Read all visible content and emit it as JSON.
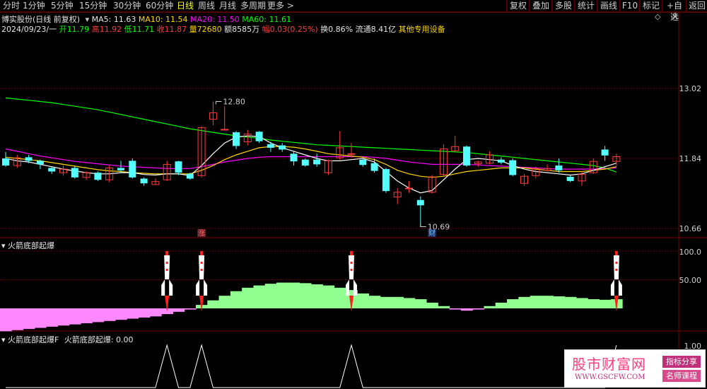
{
  "toolbar": {
    "periods": [
      "分时",
      "1分钟",
      "5分钟",
      "15分钟",
      "30分钟",
      "60分钟",
      "日线",
      "周线",
      "月线",
      "多周期",
      "更多 >"
    ],
    "active_period": "日线",
    "buttons": [
      "复权",
      "叠加",
      "多股",
      "统计",
      "画线",
      "F10",
      "标记",
      "+自选",
      "返回"
    ]
  },
  "header": {
    "stock_title": "博实股份(日线 前复权)",
    "ma5_label": "MA5: 11.63",
    "ma10_label": "MA10: 11.54",
    "ma20_label": "MA20: 11.50",
    "ma60_label": "MA60: 11.61",
    "date": "2024/09/23/一",
    "open": "开11.79",
    "high": "高11.92",
    "low": "低11.71",
    "close": "收11.87",
    "volume": "量72680",
    "amount": "额8585万",
    "change": "幅0.03(0.25%)",
    "turnover": "换0.86%",
    "float": "流通8.41亿",
    "sector": "其他专用设备"
  },
  "main_chart": {
    "y_ticks": [
      "13.02",
      "11.84",
      "10.66"
    ],
    "annotation_high": "12.80",
    "annotation_low": "10.69",
    "marker_zhang": "涨",
    "marker_cai": "财"
  },
  "indicator1": {
    "title": "火箭底部起爆",
    "y_ticks": [
      "100.0",
      "50.00"
    ]
  },
  "indicator2": {
    "title": "火箭底部起爆F",
    "subtitle": "火箭底部起爆: 0.00",
    "y_ticks": [
      "1.00"
    ]
  },
  "watermark": {
    "main": "股市财富网",
    "url": "WWW.GSCFW.COM",
    "tag1": "指标分享",
    "tag2": "名师课程"
  },
  "colors": {
    "up": "#ff3b3b",
    "down": "#54ffff",
    "ma5": "#ffffff",
    "ma10": "#ffd700",
    "ma20": "#ff00ff",
    "ma60": "#00ff00",
    "bar_green": "#90ff90",
    "bar_pink": "#ff88ff",
    "grid": "#7a0000"
  },
  "chart_data": {
    "type": "candlestick",
    "title": "博实股份(日线 前复权)",
    "ylim": [
      10.66,
      13.02
    ],
    "candles": [
      {
        "o": 11.84,
        "c": 11.72,
        "h": 11.95,
        "l": 11.7
      },
      {
        "o": 11.72,
        "c": 11.85,
        "h": 11.9,
        "l": 11.68
      },
      {
        "o": 11.86,
        "c": 11.8,
        "h": 11.9,
        "l": 11.76
      },
      {
        "o": 11.8,
        "c": 11.74,
        "h": 11.82,
        "l": 11.66
      },
      {
        "o": 11.68,
        "c": 11.62,
        "h": 11.7,
        "l": 11.58
      },
      {
        "o": 11.6,
        "c": 11.66,
        "h": 11.72,
        "l": 11.55
      },
      {
        "o": 11.68,
        "c": 11.52,
        "h": 11.72,
        "l": 11.5
      },
      {
        "o": 11.52,
        "c": 11.6,
        "h": 11.62,
        "l": 11.48
      },
      {
        "o": 11.6,
        "c": 11.48,
        "h": 11.62,
        "l": 11.46
      },
      {
        "o": 11.48,
        "c": 11.68,
        "h": 11.72,
        "l": 11.44
      },
      {
        "o": 11.68,
        "c": 11.64,
        "h": 11.8,
        "l": 11.6
      },
      {
        "o": 11.8,
        "c": 11.52,
        "h": 11.84,
        "l": 11.5
      },
      {
        "o": 11.5,
        "c": 11.42,
        "h": 11.52,
        "l": 11.38
      },
      {
        "o": 11.4,
        "c": 11.45,
        "h": 11.5,
        "l": 11.4
      },
      {
        "o": 11.48,
        "c": 11.74,
        "h": 11.8,
        "l": 11.46
      },
      {
        "o": 11.79,
        "c": 11.6,
        "h": 11.8,
        "l": 11.56
      },
      {
        "o": 11.58,
        "c": 11.5,
        "h": 11.6,
        "l": 11.48
      },
      {
        "o": 11.55,
        "c": 12.36,
        "h": 12.38,
        "l": 11.52
      },
      {
        "o": 12.5,
        "c": 12.61,
        "h": 12.8,
        "l": 12.4
      },
      {
        "o": 12.33,
        "c": 12.33,
        "h": 12.72,
        "l": 12.32
      },
      {
        "o": 12.28,
        "c": 12.05,
        "h": 12.3,
        "l": 12.0
      },
      {
        "o": 12.12,
        "c": 12.25,
        "h": 12.32,
        "l": 12.06
      },
      {
        "o": 12.29,
        "c": 12.13,
        "h": 12.3,
        "l": 12.1
      },
      {
        "o": 12.08,
        "c": 12.02,
        "h": 12.12,
        "l": 11.95
      },
      {
        "o": 12.06,
        "c": 11.99,
        "h": 12.1,
        "l": 11.95
      },
      {
        "o": 11.92,
        "c": 11.79,
        "h": 11.95,
        "l": 11.72
      },
      {
        "o": 11.82,
        "c": 11.72,
        "h": 11.84,
        "l": 11.7
      },
      {
        "o": 11.82,
        "c": 11.74,
        "h": 11.92,
        "l": 11.7
      },
      {
        "o": 11.6,
        "c": 11.8,
        "h": 11.82,
        "l": 11.56
      },
      {
        "o": 11.85,
        "c": 12.02,
        "h": 12.3,
        "l": 11.82
      },
      {
        "o": 11.92,
        "c": 11.92,
        "h": 12.1,
        "l": 11.86
      },
      {
        "o": 11.82,
        "c": 11.73,
        "h": 11.84,
        "l": 11.7
      },
      {
        "o": 11.76,
        "c": 11.63,
        "h": 11.84,
        "l": 11.6
      },
      {
        "o": 11.66,
        "c": 11.29,
        "h": 11.68,
        "l": 11.26
      },
      {
        "o": 11.19,
        "c": 11.27,
        "h": 11.34,
        "l": 11.07
      },
      {
        "o": 11.34,
        "c": 11.34,
        "h": 11.46,
        "l": 11.26
      },
      {
        "o": 11.14,
        "c": 11.05,
        "h": 11.2,
        "l": 10.69
      },
      {
        "o": 11.27,
        "c": 11.53,
        "h": 11.56,
        "l": 11.25
      },
      {
        "o": 11.57,
        "c": 12.0,
        "h": 12.08,
        "l": 11.55
      },
      {
        "o": 11.97,
        "c": 12.04,
        "h": 12.22,
        "l": 11.94
      },
      {
        "o": 12.04,
        "c": 11.72,
        "h": 12.06,
        "l": 11.7
      },
      {
        "o": 11.75,
        "c": 11.78,
        "h": 11.8,
        "l": 11.7
      },
      {
        "o": 11.76,
        "c": 11.9,
        "h": 11.96,
        "l": 11.74
      },
      {
        "o": 11.82,
        "c": 11.77,
        "h": 11.86,
        "l": 11.74
      },
      {
        "o": 11.81,
        "c": 11.56,
        "h": 11.84,
        "l": 11.54
      },
      {
        "o": 11.42,
        "c": 11.54,
        "h": 11.58,
        "l": 11.38
      },
      {
        "o": 11.55,
        "c": 11.67,
        "h": 11.7,
        "l": 11.5
      },
      {
        "o": 11.64,
        "c": 11.67,
        "h": 11.74,
        "l": 11.62
      },
      {
        "o": 11.72,
        "c": 11.64,
        "h": 11.84,
        "l": 11.6
      },
      {
        "o": 11.53,
        "c": 11.46,
        "h": 11.56,
        "l": 11.44
      },
      {
        "o": 11.46,
        "c": 11.57,
        "h": 11.62,
        "l": 11.38
      },
      {
        "o": 11.6,
        "c": 11.79,
        "h": 11.84,
        "l": 11.58
      },
      {
        "o": 11.99,
        "c": 11.89,
        "h": 12.05,
        "l": 11.8
      },
      {
        "o": 11.79,
        "c": 11.87,
        "h": 11.92,
        "l": 11.71
      }
    ],
    "ma5": [
      11.84,
      11.8,
      11.78,
      11.74,
      11.7,
      11.66,
      11.63,
      11.6,
      11.58,
      11.58,
      11.6,
      11.6,
      11.57,
      11.56,
      11.58,
      11.58,
      11.55,
      11.72,
      11.92,
      12.1,
      12.2,
      12.22,
      12.21,
      12.1,
      12.02,
      11.96,
      11.9,
      11.84,
      11.8,
      11.8,
      11.82,
      11.84,
      11.78,
      11.62,
      11.46,
      11.34,
      11.26,
      11.3,
      11.48,
      11.66,
      11.82,
      11.84,
      11.82,
      11.8,
      11.72,
      11.66,
      11.62,
      11.6,
      11.58,
      11.56,
      11.58,
      11.64,
      11.7,
      11.76
    ],
    "ma10": [
      11.86,
      11.84,
      11.82,
      11.8,
      11.77,
      11.74,
      11.71,
      11.68,
      11.65,
      11.63,
      11.62,
      11.6,
      11.59,
      11.58,
      11.58,
      11.58,
      11.58,
      11.64,
      11.72,
      11.82,
      11.9,
      11.96,
      12.02,
      12.04,
      12.04,
      12.03,
      12.0,
      11.96,
      11.92,
      11.9,
      11.88,
      11.86,
      11.82,
      11.74,
      11.64,
      11.58,
      11.54,
      11.52,
      11.54,
      11.58,
      11.62,
      11.64,
      11.66,
      11.68,
      11.68,
      11.68,
      11.66,
      11.64,
      11.62,
      11.62,
      11.62,
      11.64,
      11.66,
      11.7
    ],
    "ma20": [
      12.0,
      11.96,
      11.92,
      11.88,
      11.85,
      11.82,
      11.79,
      11.77,
      11.75,
      11.73,
      11.71,
      11.7,
      11.69,
      11.68,
      11.67,
      11.67,
      11.67,
      11.7,
      11.74,
      11.78,
      11.81,
      11.84,
      11.86,
      11.87,
      11.87,
      11.87,
      11.87,
      11.87,
      11.87,
      11.87,
      11.87,
      11.87,
      11.86,
      11.84,
      11.81,
      11.78,
      11.76,
      11.74,
      11.74,
      11.74,
      11.74,
      11.73,
      11.72,
      11.71,
      11.7,
      11.69,
      11.68,
      11.67,
      11.66,
      11.66,
      11.66,
      11.66,
      11.67,
      11.68
    ],
    "ma60": [
      12.86,
      12.84,
      12.82,
      12.8,
      12.78,
      12.75,
      12.72,
      12.69,
      12.66,
      12.62,
      12.58,
      12.54,
      12.5,
      12.46,
      12.42,
      12.38,
      12.34,
      12.31,
      12.28,
      12.25,
      12.22,
      12.2,
      12.18,
      12.15,
      12.13,
      12.11,
      12.09,
      12.07,
      12.06,
      12.05,
      12.04,
      12.03,
      12.02,
      12.01,
      12.0,
      11.99,
      11.98,
      11.97,
      11.96,
      11.95,
      11.94,
      11.92,
      11.9,
      11.88,
      11.86,
      11.84,
      11.82,
      11.8,
      11.78,
      11.76,
      11.74,
      11.72,
      11.68,
      11.61
    ],
    "indicator_values": [
      -40,
      -38,
      -36,
      -34,
      -32,
      -30,
      -28,
      -26,
      -24,
      -22,
      -20,
      -18,
      -16,
      -14,
      -10,
      -6,
      -2,
      6,
      14,
      22,
      30,
      36,
      40,
      43,
      45,
      45,
      44,
      42,
      40,
      36,
      32,
      26,
      22,
      20,
      20,
      18,
      16,
      10,
      4,
      -2,
      -4,
      -2,
      4,
      10,
      16,
      20,
      22,
      22,
      21,
      20,
      18,
      16,
      15,
      16
    ],
    "rocket_bars": [
      14,
      17,
      30,
      53
    ],
    "signal_values": [
      0,
      0,
      0,
      0,
      0,
      0,
      0,
      0,
      0,
      0,
      0,
      0,
      0,
      0,
      1,
      0,
      0,
      1,
      0,
      0,
      0,
      0,
      0,
      0,
      0,
      0,
      0,
      0,
      0,
      0,
      1,
      0,
      0,
      0,
      0,
      0,
      0,
      0,
      0,
      0,
      0,
      0,
      0,
      0,
      0,
      0,
      0,
      0,
      0,
      0,
      0,
      0,
      0,
      1
    ]
  }
}
